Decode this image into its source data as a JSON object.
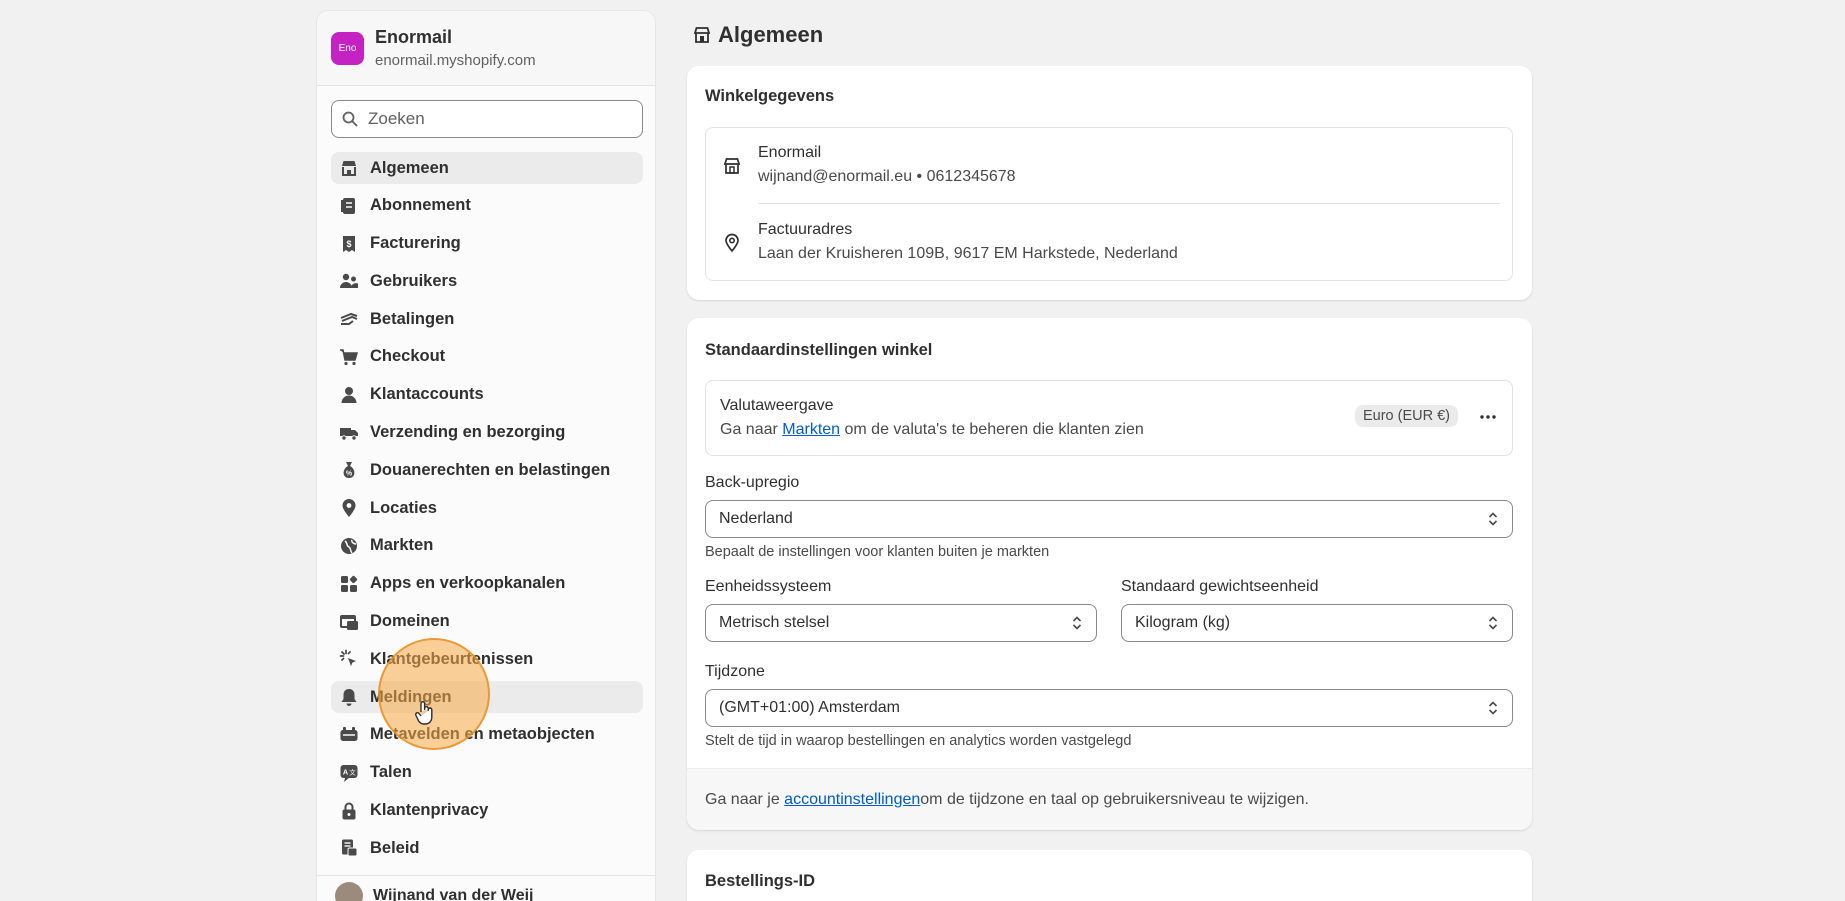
{
  "store": {
    "avatar_text": "Eno",
    "name": "Enormail",
    "url": "enormail.myshopify.com"
  },
  "search": {
    "placeholder": "Zoeken"
  },
  "nav": [
    {
      "label": "Algemeen",
      "icon": "store-icon",
      "state": "active"
    },
    {
      "label": "Abonnement",
      "icon": "plan-icon"
    },
    {
      "label": "Facturering",
      "icon": "billing-icon"
    },
    {
      "label": "Gebruikers",
      "icon": "users-icon"
    },
    {
      "label": "Betalingen",
      "icon": "payments-icon"
    },
    {
      "label": "Checkout",
      "icon": "cart-icon"
    },
    {
      "label": "Klantaccounts",
      "icon": "person-icon"
    },
    {
      "label": "Verzending en bezorging",
      "icon": "truck-icon"
    },
    {
      "label": "Douanerechten en belastingen",
      "icon": "taxes-icon"
    },
    {
      "label": "Locaties",
      "icon": "location-icon"
    },
    {
      "label": "Markten",
      "icon": "globe-icon"
    },
    {
      "label": "Apps en verkoopkanalen",
      "icon": "apps-icon"
    },
    {
      "label": "Domeinen",
      "icon": "domain-icon"
    },
    {
      "label": "Klantgebeurtenissen",
      "icon": "cursor-click-icon"
    },
    {
      "label": "Meldingen",
      "icon": "bell-icon",
      "state": "hover"
    },
    {
      "label": "Metavelden en metaobjecten",
      "icon": "metafield-icon"
    },
    {
      "label": "Talen",
      "icon": "language-icon"
    },
    {
      "label": "Klantenprivacy",
      "icon": "lock-icon"
    },
    {
      "label": "Beleid",
      "icon": "policy-icon"
    }
  ],
  "user": {
    "name": "Wijnand van der Weij"
  },
  "page": {
    "title": "Algemeen"
  },
  "store_details": {
    "title": "Winkelgegevens",
    "name": "Enormail",
    "contact": "wijnand@enormail.eu • 0612345678",
    "billing_title": "Factuuradres",
    "billing_address": "Laan der Kruisheren 109B, 9617 EM Harkstede, Nederland"
  },
  "defaults": {
    "title": "Standaardinstellingen winkel",
    "currency_title": "Valutaweergave",
    "currency_pre": "Ga naar ",
    "currency_link": "Markten",
    "currency_post": " om de valuta's te beheren die klanten zien",
    "currency_badge": "Euro (EUR €)",
    "backup_label": "Back-upregio",
    "backup_value": "Nederland",
    "backup_help": "Bepaalt de instellingen voor klanten buiten je markten",
    "unit_label": "Eenheidssysteem",
    "unit_value": "Metrisch stelsel",
    "weight_label": "Standaard gewichtseenheid",
    "weight_value": "Kilogram (kg)",
    "tz_label": "Tijdzone",
    "tz_value": "(GMT+01:00) Amsterdam",
    "tz_help": "Stelt de tijd in waarop bestellingen en analytics worden vastgelegd",
    "footer_pre": "Ga naar je ",
    "footer_link": "accountinstellingen",
    "footer_post": " om de tijdzone en taal op gebruikersniveau te wijzigen."
  },
  "order_id": {
    "title": "Bestellings-ID"
  }
}
